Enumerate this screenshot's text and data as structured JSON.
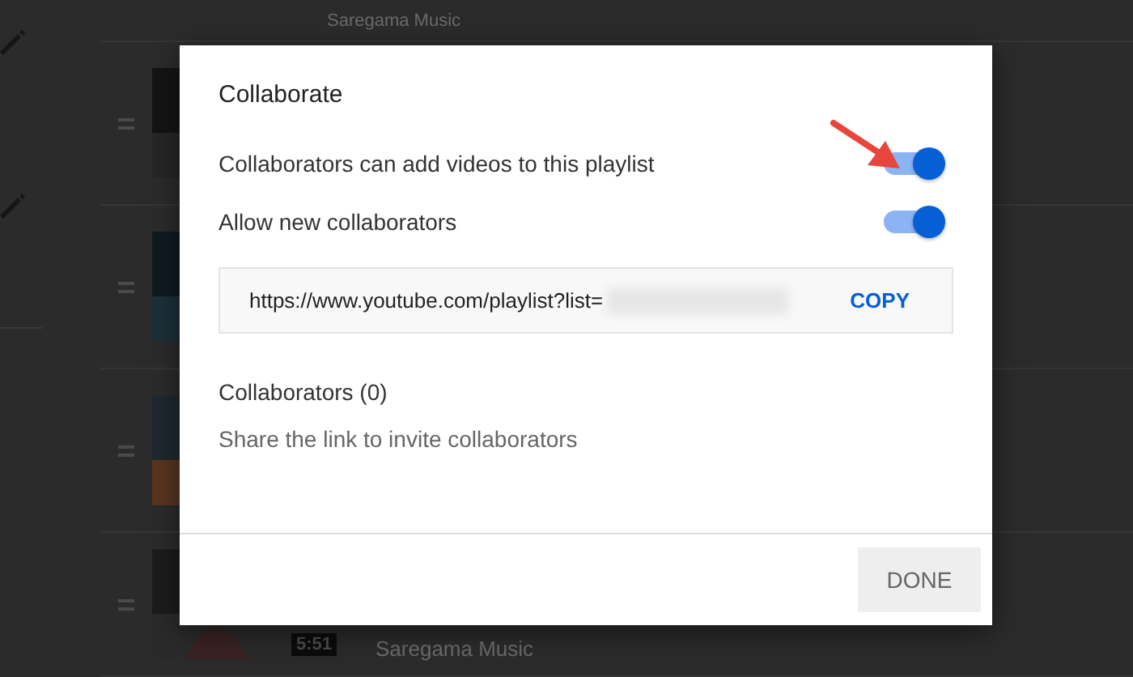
{
  "background": {
    "rows": [
      {
        "kind": "partial",
        "channel": "Saregama Music"
      },
      {
        "kind": "video"
      },
      {
        "kind": "video"
      },
      {
        "kind": "video"
      },
      {
        "kind": "video",
        "duration": "5:51",
        "channel": "Saregama Music"
      }
    ]
  },
  "dialog": {
    "title": "Collaborate",
    "toggles": [
      {
        "label": "Collaborators can add videos to this playlist",
        "on": true
      },
      {
        "label": "Allow new collaborators",
        "on": true
      }
    ],
    "link": {
      "url": "https://www.youtube.com/playlist?list=",
      "action": "COPY"
    },
    "collaborators_heading": "Collaborators (0)",
    "hint": "Share the link to invite collaborators",
    "button": "DONE"
  }
}
